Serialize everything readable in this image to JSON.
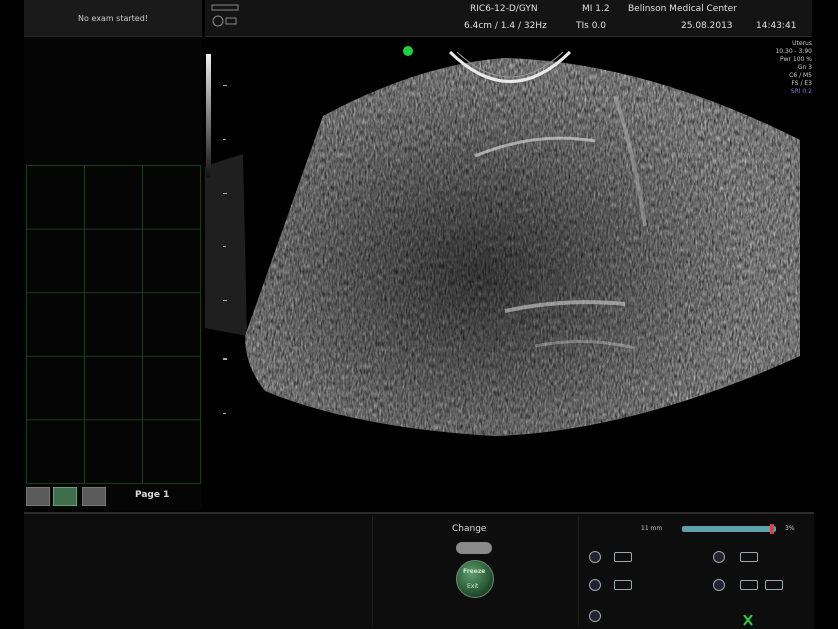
{
  "left_panel": {
    "exam_status": "No exam started!",
    "page_label": "Page 1"
  },
  "header": {
    "probe": "RIC6-12-D/GYN",
    "mi": "MI 1.2",
    "institution": "Belinson Medical Center",
    "scan_params": "6.4cm / 1.4 / 32Hz",
    "thermal_index": "TIs 0.0",
    "date": "25.08.2013",
    "time": "14:43:41"
  },
  "image_info": [
    "Uterus",
    "10.30 - 3.90",
    "Pwr 100 %",
    "Gn 3",
    "C6 / M5",
    "FS / E3",
    "SRI 0.2"
  ],
  "controls": {
    "change_label": "Change",
    "freeze_label": "Freeze",
    "exit_label": "Exit",
    "depth_label": "11 mm",
    "depth_value": "3%",
    "depth_fraction": 0.96
  },
  "colors": {
    "active_marker": "#1fd33a",
    "slider": "#5fa1a8",
    "slider_handle": "#d94242",
    "sri_text": "#6f6fff",
    "grid": "#1c3a1c"
  }
}
